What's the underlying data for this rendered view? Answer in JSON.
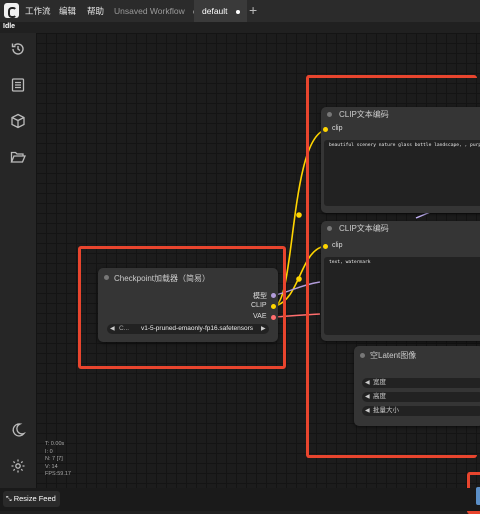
{
  "menu": [
    "工作流",
    "编辑",
    "帮助"
  ],
  "tabs": [
    {
      "label": "Unsaved Workflow",
      "active": false
    },
    {
      "label": "default",
      "active": true
    }
  ],
  "status": "Idle",
  "stats": [
    "T: 0.00s",
    "I: 0",
    "N: 7 [7]",
    "V: 14",
    "FPS:59.17"
  ],
  "bottom": {
    "resize_label": "Resize Feed"
  },
  "nodes": {
    "clip1": {
      "title": "CLIP文本编码",
      "input": "clip",
      "text": "beautiful scenery nature glass bottle landscape, , purple"
    },
    "clip2": {
      "title": "CLIP文本编码",
      "input": "clip",
      "text": "text, watermark"
    },
    "checkpoint": {
      "title": "Checkpoint加载器（简易）",
      "outputs": [
        "模型",
        "CLIP",
        "VAE"
      ],
      "widget_prefix": "C...",
      "widget_value": "v1-5-pruned-emaonly-fp16.safetensors"
    },
    "latent": {
      "title": "空Latent图像",
      "widgets": [
        "宽度",
        "高度",
        "批量大小"
      ]
    }
  },
  "colors": {
    "clip": "#ffd500",
    "model": "#b39ddb",
    "vae": "#ff6e6e",
    "highlight": "#e8452e"
  }
}
